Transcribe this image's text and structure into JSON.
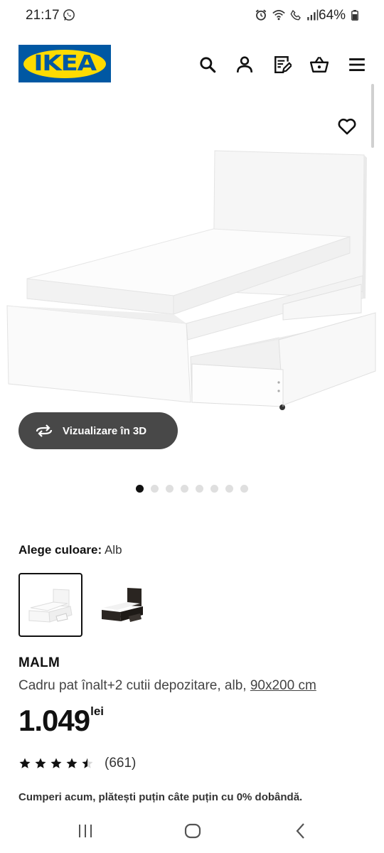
{
  "status_bar": {
    "time": "21:17",
    "battery": "64%",
    "icons": [
      "whatsapp-icon",
      "alarm-icon",
      "wifi-icon",
      "call-icon",
      "signal-icon",
      "battery-icon"
    ]
  },
  "header": {
    "logo_text": "IKEA",
    "icons": [
      "search-icon",
      "profile-icon",
      "shopping-list-icon",
      "cart-icon",
      "menu-icon"
    ]
  },
  "media": {
    "view3d_label": "Vizualizare în 3D",
    "slides_total": 8,
    "slide_active": 1
  },
  "color": {
    "label": "Alege culoare:",
    "value": "Alb",
    "options": [
      "white",
      "black-brown"
    ]
  },
  "product": {
    "name": "MALM",
    "description": "Cadru pat înalt+2 cutii depozitare, alb, ",
    "size": "90x200 cm",
    "price": "1.049",
    "currency": "lei",
    "rating_value": 4.5,
    "rating_count": "(661)",
    "finance_text": "Cumperi acum, plătești puțin câte puțin cu 0% dobândă."
  },
  "colors": {
    "brand_blue": "#0058a3",
    "brand_yellow": "#ffdb00",
    "button_dark": "#484848"
  }
}
